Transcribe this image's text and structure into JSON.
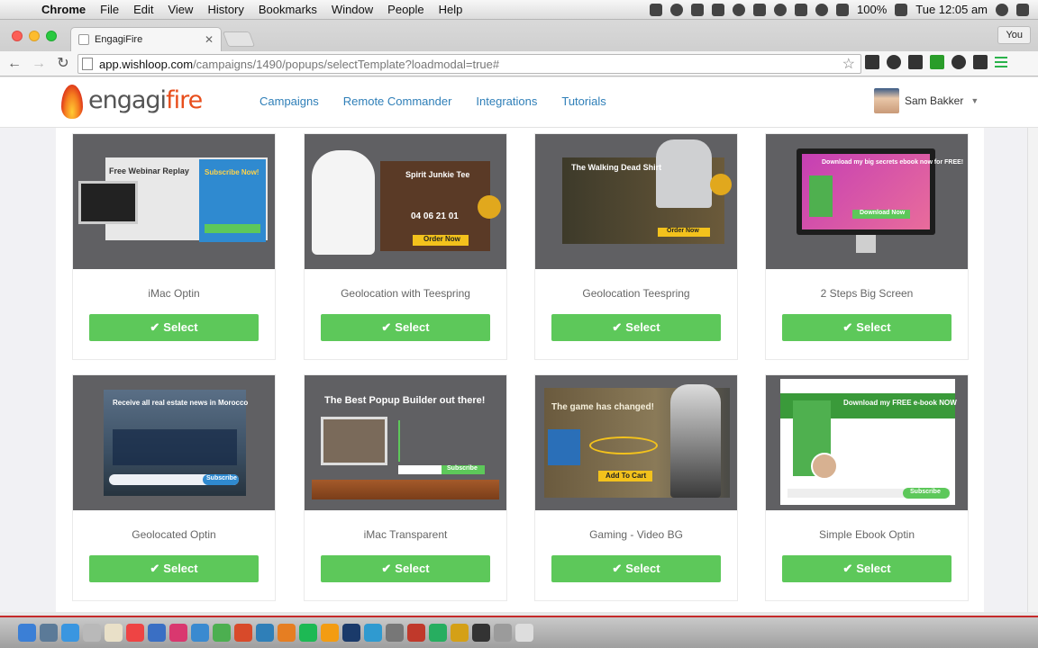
{
  "menubar": {
    "app_name": "Chrome",
    "items": [
      "File",
      "Edit",
      "View",
      "History",
      "Bookmarks",
      "Window",
      "People",
      "Help"
    ],
    "battery": "100%",
    "clock": "Tue 12:05 am",
    "status_icons": [
      "adobe-icon",
      "circle-icon",
      "sidebar-icon",
      "dropbox-icon",
      "cloud-icon",
      "checklist-icon",
      "sync-icon",
      "bluetooth-icon",
      "wifi-icon",
      "volume-icon",
      "battery-icon",
      "search-icon",
      "list-icon"
    ]
  },
  "browser": {
    "tab_title": "EngagiFire",
    "profile": "You",
    "url_host": "app.wishloop.com",
    "url_path": "/campaigns/1490/popups/selectTemplate?loadmodal=true#"
  },
  "site": {
    "logo_main": "engagi",
    "logo_accent": "fire",
    "nav": [
      "Campaigns",
      "Remote Commander",
      "Integrations",
      "Tutorials"
    ],
    "user_name": "Sam Bakker"
  },
  "templates": [
    {
      "title": "iMac Optin",
      "button": "Select",
      "thumb_text": "Free Webinar Replay",
      "thumb_sub": "Subscribe Now!"
    },
    {
      "title": "Geolocation with Teespring",
      "button": "Select",
      "thumb_text": "Spirit Junkie Tee",
      "thumb_sub": "Order Now"
    },
    {
      "title": "Geolocation Teespring",
      "button": "Select",
      "thumb_text": "The Walking Dead Shirt",
      "thumb_sub": "Order Now"
    },
    {
      "title": "2 Steps Big Screen",
      "button": "Select",
      "thumb_text": "Download my big secrets ebook now for FREE!",
      "thumb_sub": "Download Now"
    },
    {
      "title": "Geolocated Optin",
      "button": "Select",
      "thumb_text": "Receive all real estate news in Morocco",
      "thumb_sub": "Subscribe"
    },
    {
      "title": "iMac Transparent",
      "button": "Select",
      "thumb_text": "The Best Popup Builder out there!",
      "thumb_sub": "Subscribe"
    },
    {
      "title": "Gaming - Video BG",
      "button": "Select",
      "thumb_text": "The game has changed!",
      "thumb_sub": "Add To Cart"
    },
    {
      "title": "Simple Ebook Optin",
      "button": "Select",
      "thumb_text": "Download my FREE e-book NOW",
      "thumb_sub": "Subscribe"
    }
  ],
  "colors": {
    "select_button": "#5dc85a",
    "nav_link": "#2f7fb8",
    "thumb_bg": "#606063",
    "logo_flame": "#e84e1c"
  }
}
